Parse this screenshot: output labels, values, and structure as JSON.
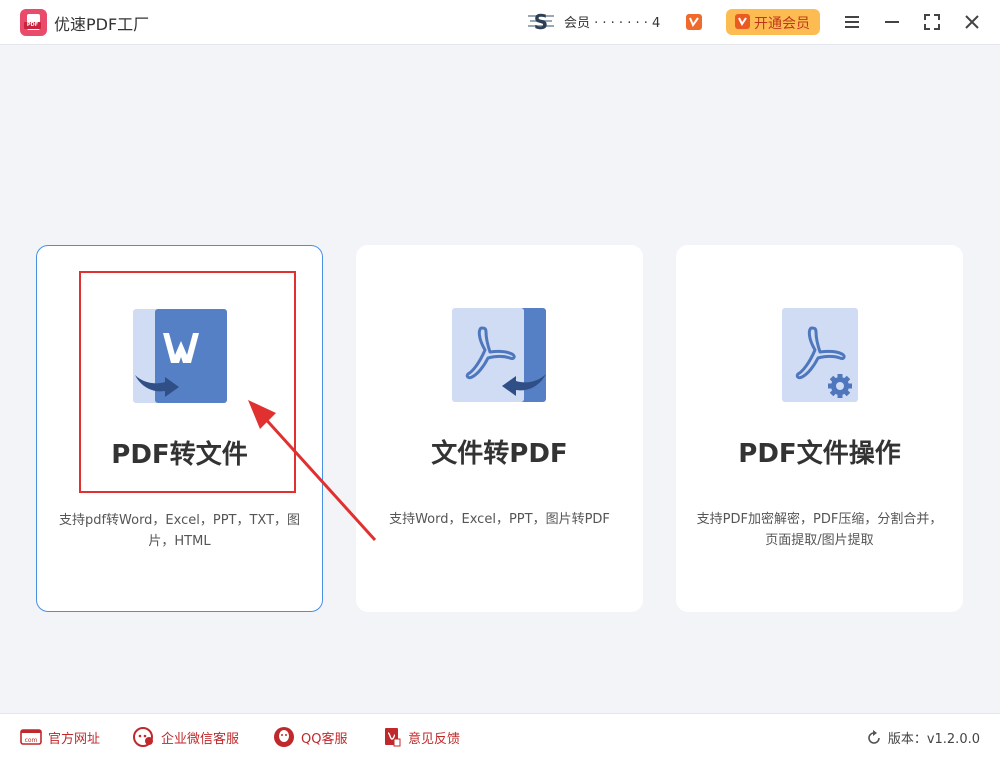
{
  "app": {
    "title": "优速PDF工厂",
    "logo_tag": "PDF"
  },
  "header": {
    "user_name": "会员 ·  ·  · · ·  ·  · 4",
    "vip_button_label": "开通会员"
  },
  "cards": [
    {
      "title": "PDF转文件",
      "desc": "支持pdf转Word，Excel，PPT，TXT，图片，HTML",
      "icon": "word-document-icon",
      "selected": true
    },
    {
      "title": "文件转PDF",
      "desc": "支持Word，Excel，PPT，图片转PDF",
      "icon": "pdf-document-icon"
    },
    {
      "title": "PDF文件操作",
      "desc": "支持PDF加密解密，PDF压缩，分割合并，页面提取/图片提取",
      "icon": "pdf-settings-icon"
    }
  ],
  "footer": {
    "links": [
      {
        "label": "官方网址",
        "icon": "website-icon"
      },
      {
        "label": "企业微信客服",
        "icon": "wechat-icon"
      },
      {
        "label": "QQ客服",
        "icon": "qq-icon"
      },
      {
        "label": "意见反馈",
        "icon": "feedback-icon"
      }
    ],
    "version": "版本：v1.2.0.0"
  },
  "colors": {
    "accent": "#4a90e2",
    "brand": "#e94b6b",
    "vip": "#fdbc52",
    "icon_blue": "#5680c6",
    "icon_light": "#cfdcf4",
    "annotation": "#e03030"
  }
}
